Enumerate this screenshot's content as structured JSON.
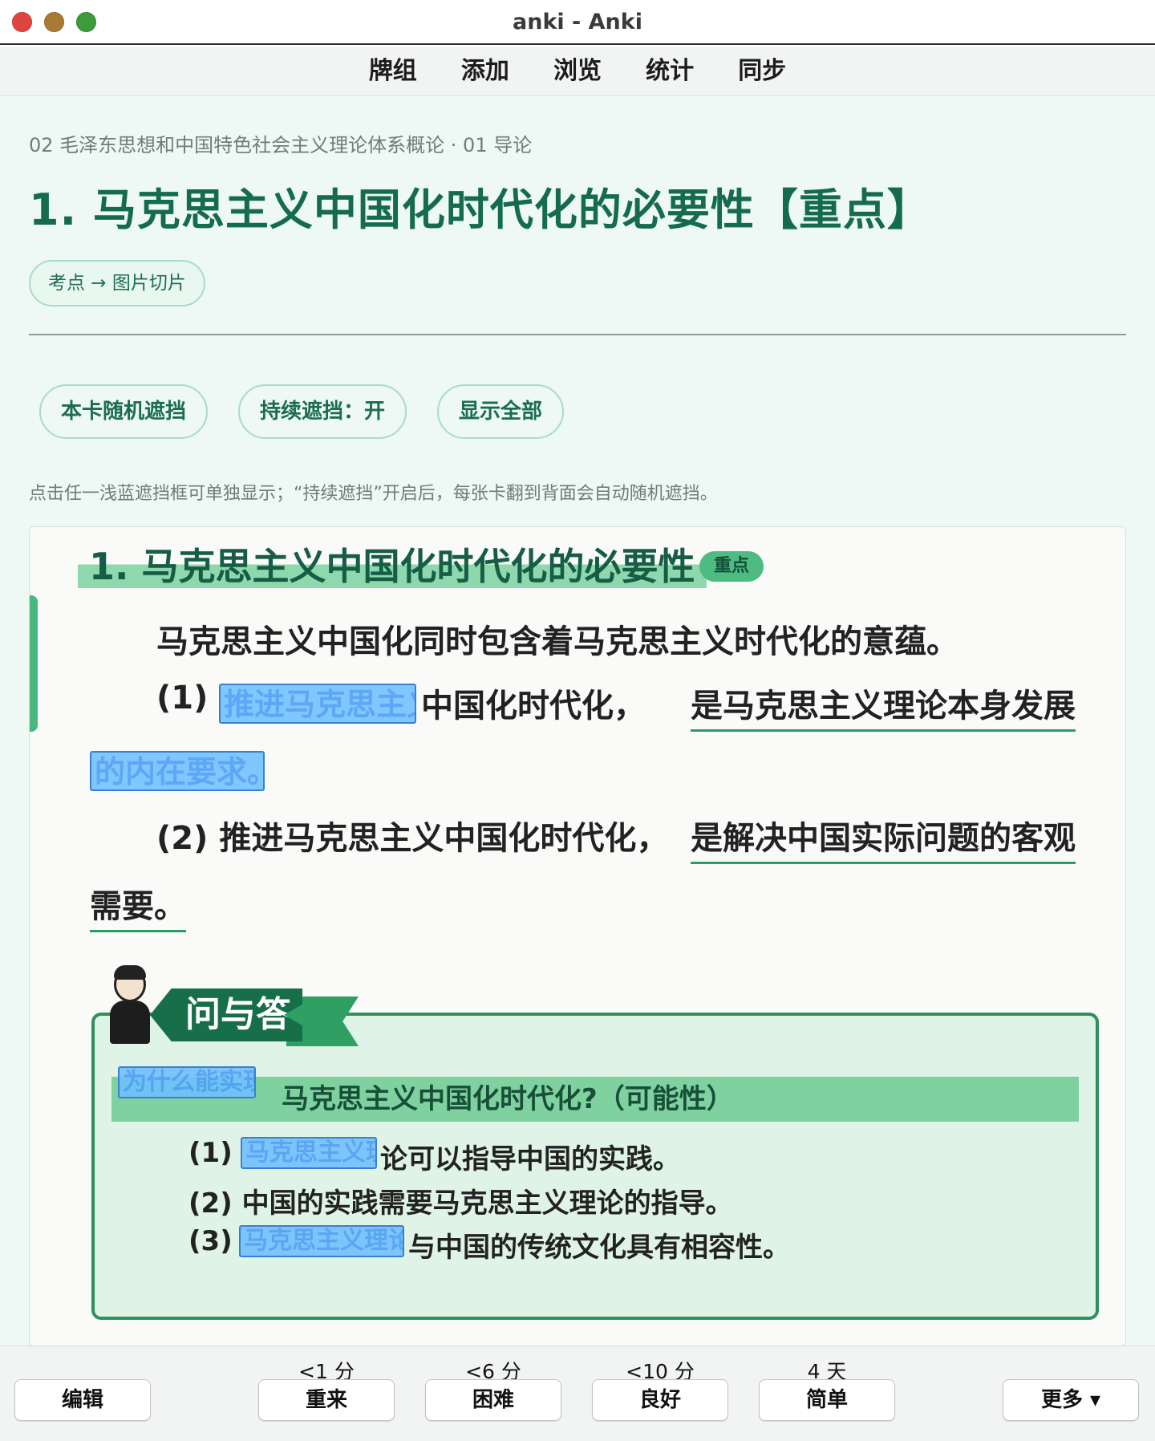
{
  "window": {
    "title": "anki - Anki"
  },
  "toolbar": {
    "items": [
      "牌组",
      "添加",
      "浏览",
      "统计",
      "同步"
    ]
  },
  "card": {
    "breadcrumb": "02 毛泽东思想和中国特色社会主义理论体系概论 · 01 导论",
    "title": "1. 马克思主义中国化时代化的必要性【重点】",
    "tag": "考点 → 图片切片",
    "controls": {
      "random_mask": "本卡随机遮挡",
      "persistent_mask": "持续遮挡：开",
      "show_all": "显示全部"
    },
    "hint": "点击任一浅蓝遮挡框可单独显示；“持续遮挡”开启后，每张卡翻到背面会自动随机遮挡。"
  },
  "scan": {
    "heading": "1. 马克思主义中国化时代化的必要性",
    "badge": "重点",
    "para1": "马克思主义中国化同时包含着马克思主义时代化的意蕴。",
    "p2_num": "(1)",
    "p2_mask": "推进马克思主义",
    "p2_rest": "中国化时代化，",
    "p2_ul": "是马克思主义理论本身发展",
    "p2_cont_mask": "的内在要求。",
    "p3_lead": "(2) 推进马克思主义中国化时代化，",
    "p3_ul": "是解决中国实际问题的客观",
    "p3_cont": "需要。",
    "qa_label": "问与答",
    "qa_question_mask": "为什么能实现",
    "qa_question_rest": "马克思主义中国化时代化?（可能性）",
    "qa1_num": "(1)",
    "qa1_mask": "马克思主义理",
    "qa1_rest": "论可以指导中国的实践。",
    "qa2": "(2) 中国的实践需要马克思主义理论的指导。",
    "qa3_num": "(3)",
    "qa3_mask": "马克思主义理论",
    "qa3_rest": "与中国的传统文化具有相容性。"
  },
  "answer_bar": {
    "edit": "编辑",
    "more": "更多 ▾",
    "buttons": [
      {
        "time": "<1 分",
        "label": "重来"
      },
      {
        "time": "<6 分",
        "label": "困难"
      },
      {
        "time": "<10 分",
        "label": "良好"
      },
      {
        "time": "4 天",
        "label": "简单"
      }
    ]
  },
  "colors": {
    "accent": "#146b4f",
    "mask": "#6ebeff",
    "highlight": "#8fd8ad",
    "card_bg": "#eef8f4"
  }
}
